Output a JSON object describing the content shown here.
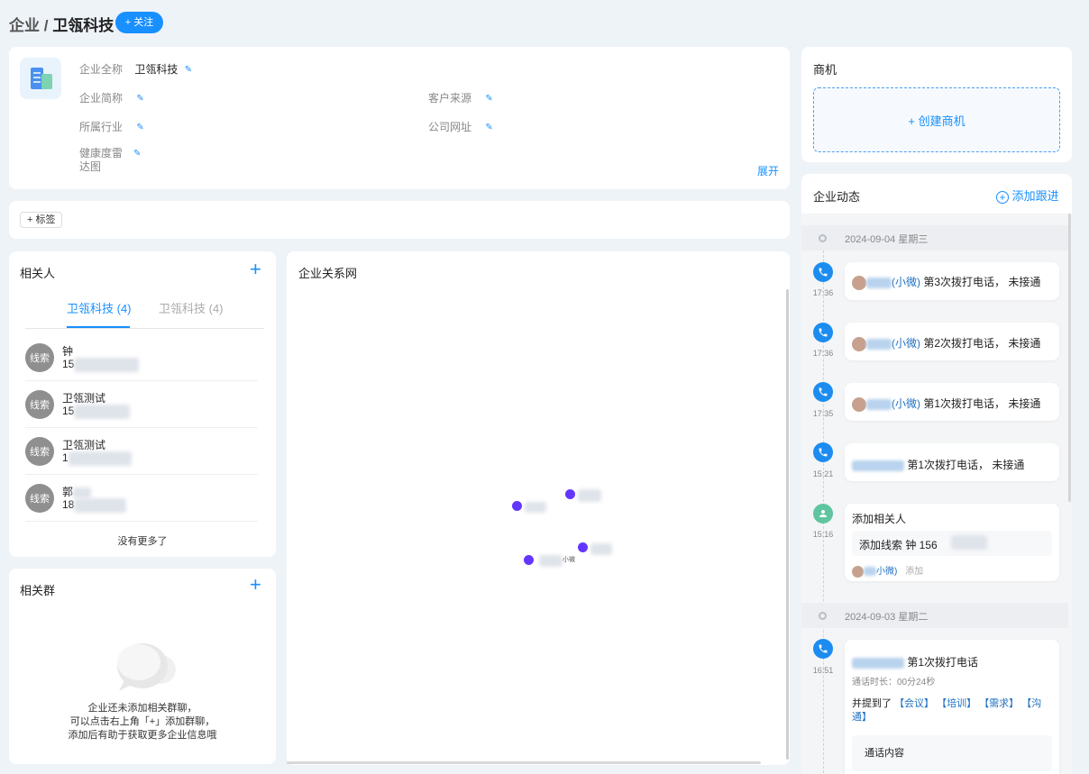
{
  "header": {
    "breadcrumb_parent": "企业",
    "breadcrumb_sep": "/",
    "company_name": "卫瓴科技",
    "follow_label": "+ 关注"
  },
  "profile": {
    "full_name_label": "企业全称",
    "full_name_value": "卫瓴科技",
    "short_name_label": "企业简称",
    "industry_label": "所属行业",
    "health_label_line1": "健康度雷",
    "health_label_line2": "达图",
    "source_label": "客户来源",
    "website_label": "公司网址",
    "expand_label": "展开"
  },
  "tags": {
    "add_label": "+ 标签"
  },
  "contacts": {
    "title": "相关人",
    "tabs": [
      {
        "label": "卫瓴科技 (4)"
      },
      {
        "label": "卫瓴科技 (4)"
      }
    ],
    "items": [
      {
        "badge": "线索",
        "name": "钟",
        "phone": "15"
      },
      {
        "badge": "线索",
        "name": "卫瓴测试",
        "phone": "15"
      },
      {
        "badge": "线索",
        "name": "卫瓴测试",
        "phone": "1"
      },
      {
        "badge": "线索",
        "name": "郭",
        "phone": "18"
      }
    ],
    "no_more": "没有更多了"
  },
  "groups": {
    "title": "相关群",
    "empty_line1": "企业还未添加相关群聊，",
    "empty_line2": "可以点击右上角「+」添加群聊，",
    "empty_line3": "添加后有助于获取更多企业信息哦"
  },
  "network": {
    "title": "企业关系网",
    "node_small_label": "小微"
  },
  "opportunity": {
    "title": "商机",
    "create_label": "+ 创建商机"
  },
  "activity": {
    "title": "企业动态",
    "add_follow_label": "添加跟进",
    "day1": "2024-09-04 星期三",
    "day2": "2024-09-03 星期二",
    "events": [
      {
        "time": "17:36",
        "name": "(小微)",
        "text": "第3次拨打电话， 未接通"
      },
      {
        "time": "17:36",
        "name": "(小微)",
        "text": "第2次拨打电话， 未接通"
      },
      {
        "time": "17:35",
        "name": "(小微)",
        "text": "第1次拨打电话， 未接通"
      },
      {
        "time": "15:21",
        "name": "",
        "text": "第1次拨打电话， 未接通"
      }
    ],
    "add_contact": {
      "time": "15:16",
      "title": "添加相关人",
      "detail": "添加线索 钟 156",
      "actor": "小微)",
      "action": "添加"
    },
    "call": {
      "time": "16:51",
      "text": "第1次拨打电话",
      "duration": "通话时长：00分24秒",
      "mention_prefix": "并提到了",
      "tag1": "【会议】",
      "tag2": "【培训】",
      "tag3": "【需求】",
      "tag4": "【沟通】",
      "content_label": "通话内容"
    }
  },
  "colors": {
    "accent": "#1890ff",
    "phone_icon": "#1c8cf0",
    "node": "#6236ff",
    "contact_icon": "#5fc5a0"
  }
}
